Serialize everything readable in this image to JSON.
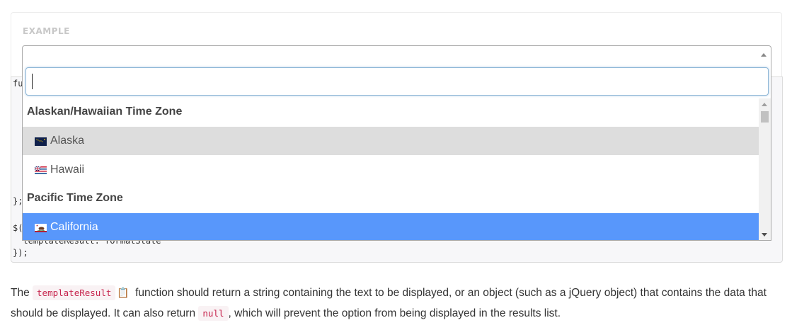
{
  "example": {
    "label": "EXAMPLE"
  },
  "code": {
    "line1": "fu",
    "line2": "};",
    "line3": "$(",
    "line4": "  templateResult: formatState",
    "line5": "});"
  },
  "select": {
    "value": ""
  },
  "search": {
    "value": ""
  },
  "results": {
    "groups": [
      {
        "label": "Alaskan/Hawaiian Time Zone",
        "options": [
          {
            "label": "Alaska",
            "flag": "alaska-flag-icon"
          },
          {
            "label": "Hawaii",
            "flag": "hawaii-flag-icon"
          }
        ]
      },
      {
        "label": "Pacific Time Zone",
        "options": [
          {
            "label": "California",
            "flag": "california-flag-icon"
          }
        ]
      }
    ]
  },
  "colors": {
    "highlight": "#5897fb",
    "hover": "#dddddd",
    "code_text": "#c7254e"
  },
  "paragraph": {
    "t1": "The ",
    "code1": "templateResult",
    "t2": " function should return a string containing the text to be displayed, or an object (such as a jQuery object) that contains the data that should be displayed. It can also return ",
    "code2": "null",
    "t3": ", which will prevent the option from being displayed in the results list."
  }
}
